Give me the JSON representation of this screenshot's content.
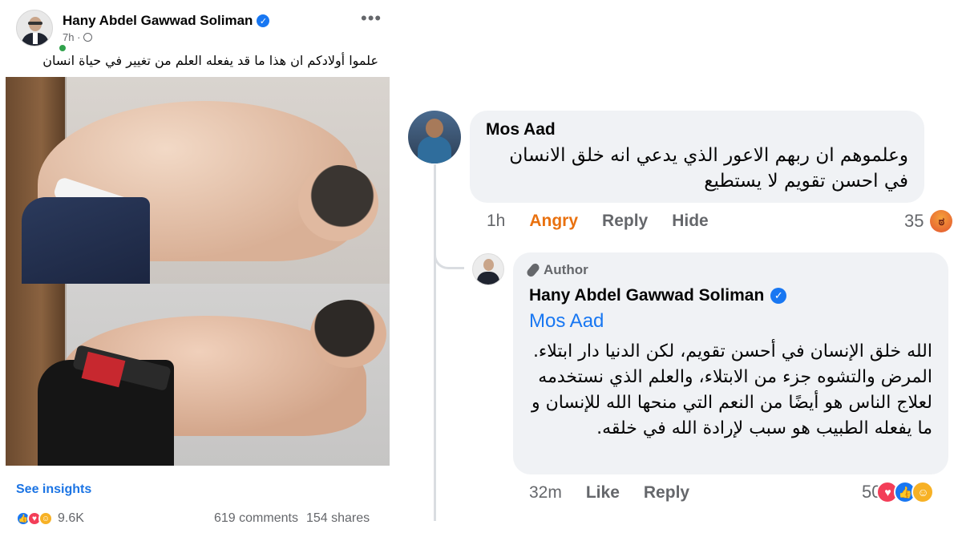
{
  "post": {
    "author": "Hany Abdel Gawwad Soliman",
    "time": "7h ·",
    "text": "علموا أولادكم ان هذا ما قد يفعله العلم من تغيير في حياة انسان",
    "insights_link": "See insights",
    "reaction_count": "9.6K",
    "comments_count": "619 comments",
    "shares_count": "154 shares",
    "reaction_icons": [
      "like-icon",
      "love-icon",
      "care-icon"
    ]
  },
  "comments": [
    {
      "author": "Mos Aad",
      "text": "وعلموهم ان ربهم الاعور الذي يدعي انه خلق الانسان في احسن تقويم لا يستطيع",
      "time": "1h",
      "reaction_label": "Angry",
      "reply_label": "Reply",
      "hide_label": "Hide",
      "reaction_count": "35",
      "reaction_icons": [
        "angry-icon"
      ]
    },
    {
      "badge": "Author",
      "author": "Hany Abdel Gawwad Soliman",
      "mention": "Mos Aad",
      "text": "الله خلق الإنسان في أحسن تقويم، لكن الدنيا دار ابتلاء. المرض والتشوه جزء من الابتلاء، والعلم الذي نستخدمه لعلاج الناس هو أيضًا من النعم التي منحها الله للإنسان و ما يفعله الطبيب هو سبب لإرادة الله في خلقه.",
      "time": "32m",
      "like_label": "Like",
      "reply_label": "Reply",
      "reaction_count": "50",
      "reaction_icons": [
        "love-icon",
        "like-icon",
        "care-icon"
      ]
    }
  ],
  "colors": {
    "facebook_blue": "#1877f2",
    "angry_orange": "#e9710f",
    "bubble_bg": "#f0f2f5",
    "muted_text": "#65676b"
  }
}
